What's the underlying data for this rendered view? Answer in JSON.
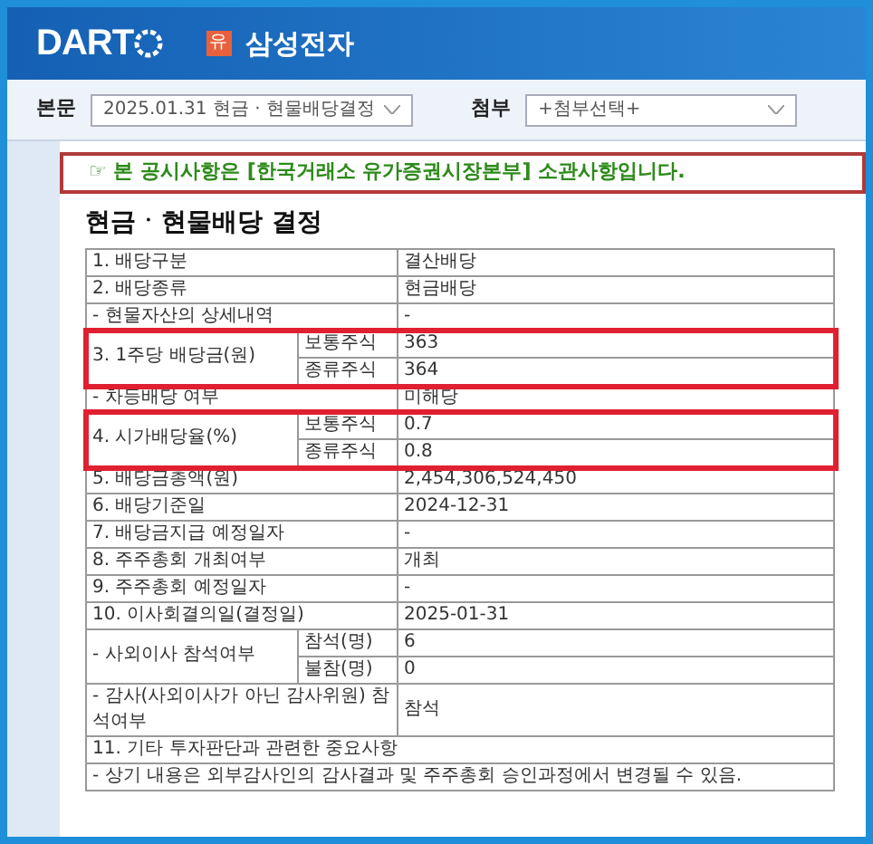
{
  "header": {
    "logo": "DART",
    "market_badge": "유",
    "company": "삼성전자"
  },
  "toolbar": {
    "body_label": "본문",
    "body_select": "2025.01.31  현금 · 현물배당결정",
    "attach_label": "첨부",
    "attach_select": "+첨부선택+"
  },
  "notice": "☞ 본 공시사항은 [한국거래소 유가증권시장본부] 소관사항입니다.",
  "title": "현금ㆍ현물배당 결정",
  "rows": [
    {
      "kind": "single",
      "label": "1. 배당구분",
      "value": "결산배당"
    },
    {
      "kind": "single",
      "label": "2. 배당종류",
      "value": "현금배당"
    },
    {
      "kind": "single",
      "label": "- 현물자산의 상세내역",
      "value": "-"
    },
    {
      "kind": "split",
      "label": "3. 1주당 배당금(원)",
      "highlighted": true,
      "subrows": [
        {
          "label": "보통주식",
          "value": "363"
        },
        {
          "label": "종류주식",
          "value": "364"
        }
      ]
    },
    {
      "kind": "single",
      "label": "- 차등배당 여부",
      "value": "미해당"
    },
    {
      "kind": "split",
      "label": "4. 시가배당율(%)",
      "highlighted": true,
      "subrows": [
        {
          "label": "보통주식",
          "value": "0.7"
        },
        {
          "label": "종류주식",
          "value": "0.8"
        }
      ]
    },
    {
      "kind": "single",
      "label": "5. 배당금총액(원)",
      "value": "2,454,306,524,450"
    },
    {
      "kind": "single",
      "label": "6. 배당기준일",
      "value": "2024-12-31"
    },
    {
      "kind": "single",
      "label": "7. 배당금지급 예정일자",
      "value": "-"
    },
    {
      "kind": "single",
      "label": "8. 주주총회 개최여부",
      "value": "개최"
    },
    {
      "kind": "single",
      "label": "9. 주주총회 예정일자",
      "value": "-"
    },
    {
      "kind": "single",
      "label": "10. 이사회결의일(결정일)",
      "value": "2025-01-31"
    },
    {
      "kind": "split",
      "label": "- 사외이사 참석여부",
      "highlighted": false,
      "subrows": [
        {
          "label": "참석(명)",
          "value": "6"
        },
        {
          "label": "불참(명)",
          "value": "0"
        }
      ]
    },
    {
      "kind": "single",
      "label": "- 감사(사외이사가 아닌 감사위원) 참석여부",
      "value": "참석"
    },
    {
      "kind": "full",
      "label": "11. 기타 투자판단과 관련한 중요사항"
    },
    {
      "kind": "full",
      "label": "- 상기 내용은 외부감사인의 감사결과 및 주주총회 승인과정에서 변경될 수 있음."
    }
  ]
}
